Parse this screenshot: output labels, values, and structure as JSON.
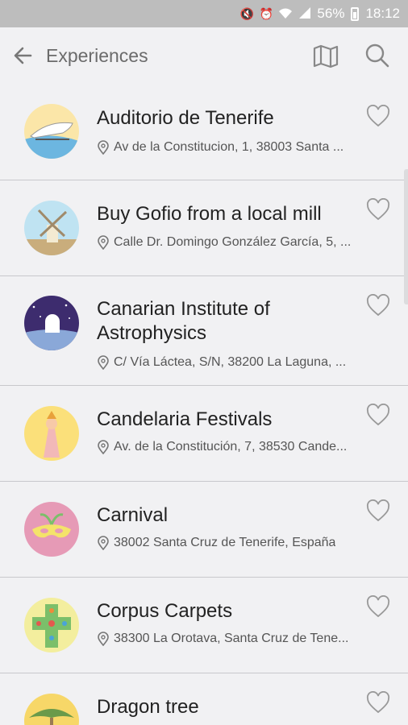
{
  "status": {
    "battery": "56%",
    "time": "18:12"
  },
  "appbar": {
    "title": "Experiences"
  },
  "items": [
    {
      "name": "Auditorio de Tenerife",
      "address": "Av de la Constitucion, 1, 38003 Santa ..."
    },
    {
      "name": "Buy Gofio from a local mill",
      "address": "Calle Dr. Domingo González García, 5, ..."
    },
    {
      "name": "Canarian Institute of Astrophysics",
      "address": "C/ Vía Láctea, S/N, 38200 La Laguna, ..."
    },
    {
      "name": "Candelaria Festivals",
      "address": "Av. de la Constitución, 7, 38530 Cande..."
    },
    {
      "name": "Carnival",
      "address": "38002 Santa Cruz de Tenerife, España"
    },
    {
      "name": "Corpus Carpets",
      "address": "38300 La Orotava, Santa Cruz de Tene..."
    },
    {
      "name": "Dragon tree",
      "address": ""
    }
  ]
}
